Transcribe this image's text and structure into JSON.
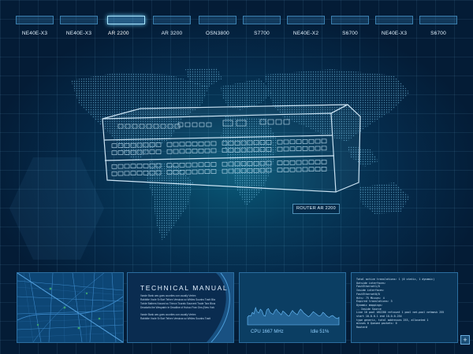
{
  "tabs": [
    {
      "label": "NE40E-X3",
      "active": false
    },
    {
      "label": "NE40E-X3",
      "active": false
    },
    {
      "label": "AR 2200",
      "active": true
    },
    {
      "label": "AR 3200",
      "active": false
    },
    {
      "label": "OSN3800",
      "active": false
    },
    {
      "label": "S7700",
      "active": false
    },
    {
      "label": "NE40E-X2",
      "active": false
    },
    {
      "label": "S6700",
      "active": false
    },
    {
      "label": "NE40E-X3",
      "active": false
    },
    {
      "label": "S6700",
      "active": false
    }
  ],
  "device": {
    "label": "ROUTER AR 2200"
  },
  "panels": {
    "manual": {
      "title": "TECHNICAL MANUAL",
      "lines": [
        "Vande Bank aes goes counties con usually   Vertex",
        "Rabbitte Vocle Sr Bort Telhen Versiuss so Whiles Sounbs Trarit  Bloomberg",
        "Toride Bathers Nocard su Trimon Tourals Sourcent Trade Tarz Bloomberg",
        "Deaduriis the Wespatriv le Deadline of Hubuo Fran Ons  (New York Times"
      ],
      "lines2": [
        "Vande Bank aes goes counties con usually   Vertex",
        "Rabbitte Vocle Sr Bort Telhen Versiuss so Whiles Sounbs Trarit"
      ]
    },
    "cpu": {
      "cpu_label": "CPU 1667 MHz",
      "idle_label": "Idle 51%",
      "series": [
        0.25,
        0.3,
        0.28,
        0.4,
        0.35,
        0.55,
        0.42,
        0.38,
        0.5,
        0.45,
        0.3,
        0.28,
        0.48,
        0.52,
        0.4,
        0.36,
        0.34,
        0.45,
        0.5,
        0.42,
        0.38,
        0.32,
        0.44,
        0.4,
        0.35,
        0.3,
        0.28,
        0.38,
        0.46,
        0.4,
        0.36,
        0.32,
        0.42,
        0.5,
        0.45,
        0.38,
        0.34,
        0.3,
        0.26,
        0.3,
        0.36,
        0.42,
        0.38,
        0.34,
        0.3,
        0.28,
        0.32,
        0.4,
        0.36,
        0.3,
        0.26,
        0.24,
        0.28,
        0.3,
        0.26,
        0.22,
        0.2,
        0.24
      ]
    },
    "terminal": {
      "lines": [
        "Total active translations: 1 (0 static, 1 dynamic)",
        "Outside interfaces:",
        "    FastEthernet1/0",
        "Inside interfaces:",
        "    FastEthernet0/0",
        "Hits: 75  Misses: 4",
        "Expired translations: 3",
        "Dynamic mappings:",
        "-- Inside Source",
        "Line 10  pool AR2200 refcount 1  pool nat-pool netmask 255",
        "start 10.0.0.1  end 10.0.0.254",
        "  type generic, total addresses 253, allocated 1",
        "  misses 0  Queued packets: 0",
        "Router#"
      ]
    }
  },
  "colors": {
    "accent": "#6fd3ff",
    "panel_border": "#2b6ea0",
    "wire": "#cfe6f7"
  }
}
